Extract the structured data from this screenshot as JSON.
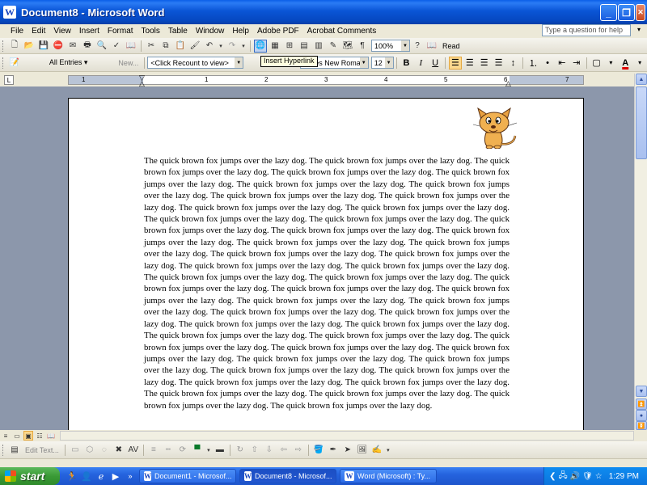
{
  "window": {
    "title": "Document8 - Microsoft Word",
    "app_icon": "W"
  },
  "menubar": {
    "items": [
      "File",
      "Edit",
      "View",
      "Insert",
      "Format",
      "Tools",
      "Table",
      "Window",
      "Help",
      "Adobe PDF",
      "Acrobat Comments"
    ],
    "ask_placeholder": "Type a question for help"
  },
  "standard_toolbar": {
    "zoom": "100%",
    "read_label": "Read"
  },
  "mail_toolbar": {
    "all_entries": "All Entries ▾",
    "new_label": "New...",
    "recount": "<Click Recount to view>"
  },
  "formatting_toolbar": {
    "font": "Times New Roman",
    "size": "12",
    "bold": "B",
    "italic": "I",
    "underline": "U"
  },
  "tooltip": "Insert Hyperlink",
  "ruler": {
    "numbers": [
      "1",
      "1",
      "2",
      "3",
      "4",
      "5",
      "6",
      "7"
    ]
  },
  "document": {
    "paragraph": "The quick brown fox jumps over the lazy dog.  The quick brown fox jumps over the lazy dog.  The quick brown fox jumps over the lazy dog.  The quick brown fox jumps over the lazy dog.  The quick brown fox jumps over the lazy dog.  The quick brown fox jumps over the lazy dog.  The quick brown fox jumps over the lazy dog.  The quick brown fox jumps over the lazy dog.  The quick brown fox jumps over the lazy dog.  The quick brown fox jumps over the lazy dog.  The quick brown fox jumps over the lazy dog.  The quick brown fox jumps over the lazy dog.  The quick brown fox jumps over the lazy dog.  The quick brown fox jumps over the lazy dog.  The quick brown fox jumps over the lazy dog.  The quick brown fox jumps over the lazy dog.  The quick brown fox jumps over the lazy dog.  The quick brown fox jumps over the lazy dog.  The quick brown fox jumps over the lazy dog.  The quick brown fox jumps over the lazy dog.  The quick brown fox jumps over the lazy dog.  The quick brown fox jumps over the lazy dog.  The quick brown fox jumps over the lazy dog.  The quick brown fox jumps over the lazy dog.  The quick brown fox jumps over the lazy dog.  The quick brown fox jumps over the lazy dog.  The quick brown fox jumps over the lazy dog.  The quick brown fox jumps over the lazy dog.  The quick brown fox jumps over the lazy dog.  The quick brown fox jumps over the lazy dog.  The quick brown fox jumps over the lazy dog.  The quick brown fox jumps over the lazy dog.  The quick brown fox jumps over the lazy dog.  The quick brown fox jumps over the lazy dog.  The quick brown fox jumps over the lazy dog.  The quick brown fox jumps over the lazy dog.  The quick brown fox jumps over the lazy dog.  The quick brown fox jumps over the lazy dog.  The quick brown fox jumps over the lazy dog.  The quick brown fox jumps over the lazy dog.  The quick brown fox jumps over the lazy dog.  The quick brown fox jumps over the lazy dog.  The quick brown fox jumps over the lazy dog.  The quick brown fox jumps over the lazy dog.  The quick brown fox jumps over the lazy dog.  The quick brown fox jumps over the lazy dog.  The quick brown fox jumps over the lazy dog.  The quick brown fox jumps over the lazy dog."
  },
  "drawing_toolbar": {
    "edit_text": "Edit Text..."
  },
  "taskbar": {
    "start_label": "start",
    "items": [
      "Document1 - Microsof...",
      "Document8 - Microsof...",
      "Word (Microsoft) : Ty..."
    ],
    "clock": "1:29 PM"
  }
}
